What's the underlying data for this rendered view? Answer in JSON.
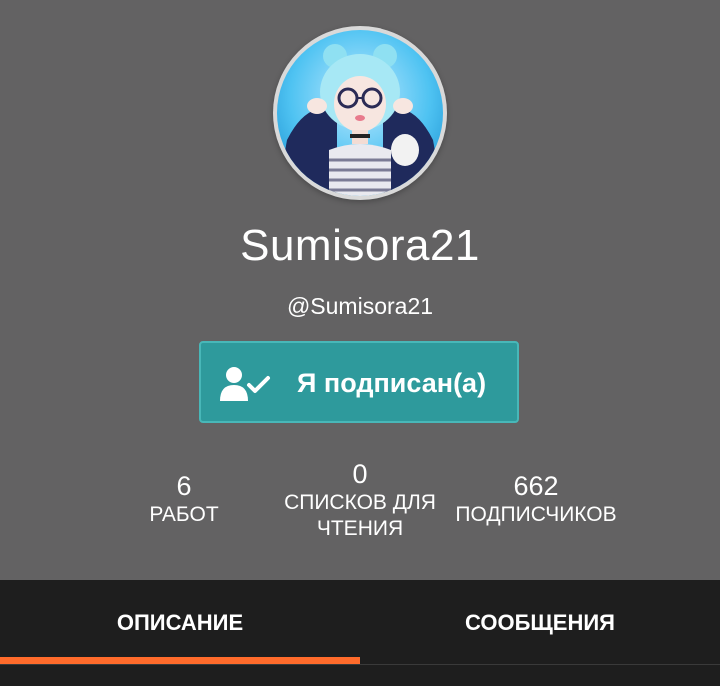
{
  "profile": {
    "display_name": "Sumisora21",
    "handle": "@Sumisora21"
  },
  "follow_button": {
    "label": "Я подписан(а)",
    "icon": "user-check-icon",
    "color": "#2e9a9c"
  },
  "stats": [
    {
      "value": "6",
      "label": "РАБОТ"
    },
    {
      "value": "0",
      "label_line1": "СПИСКОВ ДЛЯ",
      "label_line2": "ЧТЕНИЯ"
    },
    {
      "value": "662",
      "label": "ПОДПИСЧИКОВ"
    }
  ],
  "tabs": [
    {
      "label": "ОПИСАНИЕ",
      "active": true
    },
    {
      "label": "СООБЩЕНИЯ",
      "active": false
    }
  ],
  "colors": {
    "background": "#636263",
    "tab_bar": "#1e1e1e",
    "active_tab_indicator": "#ff6b2b"
  }
}
